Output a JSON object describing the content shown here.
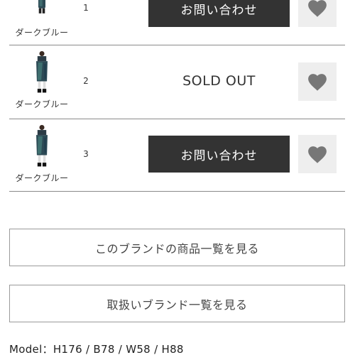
{
  "colors": {
    "dark_button": "#333333",
    "favorite_bg": "#eeeeee",
    "favorite_icon": "#777777",
    "divider": "#8a8a8a"
  },
  "items": [
    {
      "color_label": "ダークブルー",
      "size": "1",
      "action_label": "お問い合わせ",
      "state": "inquiry",
      "favorite_icon": "heart-icon"
    },
    {
      "color_label": "ダークブルー",
      "size": "2",
      "action_label": "SOLD OUT",
      "state": "sold-out",
      "favorite_icon": "heart-icon"
    },
    {
      "color_label": "ダークブルー",
      "size": "3",
      "action_label": "お問い合わせ",
      "state": "inquiry",
      "favorite_icon": "heart-icon"
    }
  ],
  "links": {
    "brand_products": "このブランドの商品一覧を見る",
    "all_brands": "取扱いブランド一覧を見る"
  },
  "model_info": "Model：H176 / B78 / W58 / H88"
}
